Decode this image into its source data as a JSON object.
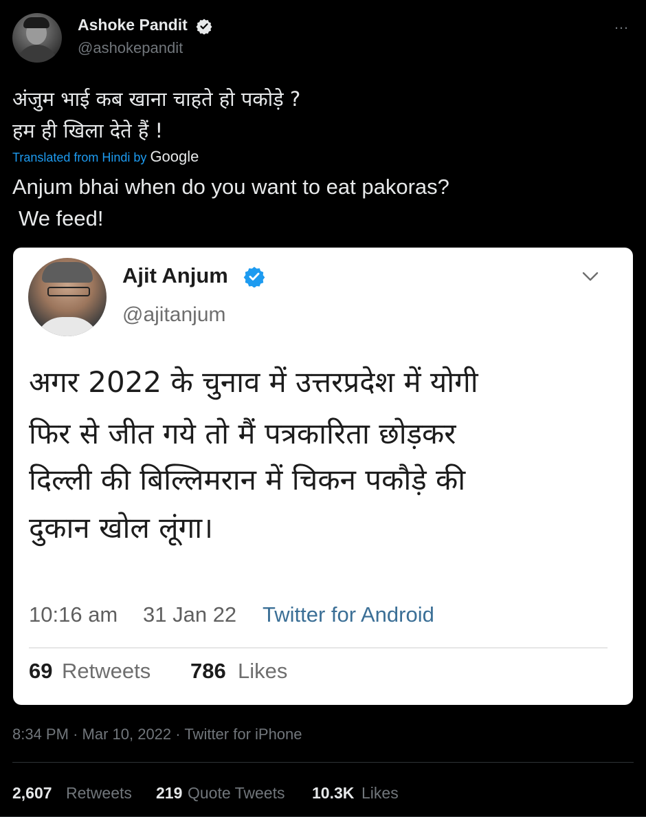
{
  "tweet": {
    "author_name": "Ashoke Pandit",
    "author_handle": "@ashokepandit",
    "more_icon": "…",
    "hindi_line1": "अंजुम भाई कब खाना चाहते हो पकोड़े ?",
    "hindi_line2": "हम ही खिला देते हैं !",
    "translated_label": "Translated from Hindi by",
    "translator": "Google",
    "english_line1": "Anjum bhai when do you want to eat pakoras?",
    "english_line2": "We feed!",
    "time": "8:34 PM",
    "date": "Mar 10, 2022",
    "source": "Twitter for iPhone",
    "separator": "·",
    "stats": {
      "retweets_count": "2,607",
      "retweets_label": "Retweets",
      "quotes_count": "219",
      "quotes_label": "Quote Tweets",
      "likes_count": "10.3K",
      "likes_label": "Likes"
    }
  },
  "embedded": {
    "author_name": "Ajit Anjum",
    "author_handle": "@ajitanjum",
    "text_lines": [
      "अगर 2022 के चुनाव में उत्तरप्रदेश में योगी",
      "फिर से जीत गये तो मैं पत्रकारिता छोड़कर",
      "दिल्ली की बिल्लिमरान में चिकन पकौड़े की",
      "दुकान खोल लूंगा।"
    ],
    "time": "10:16 am",
    "date": "31 Jan 22",
    "source": "Twitter for Android",
    "retweets_count": "69",
    "retweets_label": "Retweets",
    "likes_count": "786",
    "likes_label": "Likes"
  },
  "colors": {
    "background": "#000000",
    "accent": "#1d9bf0",
    "muted": "#71767b",
    "card": "#ffffff"
  }
}
